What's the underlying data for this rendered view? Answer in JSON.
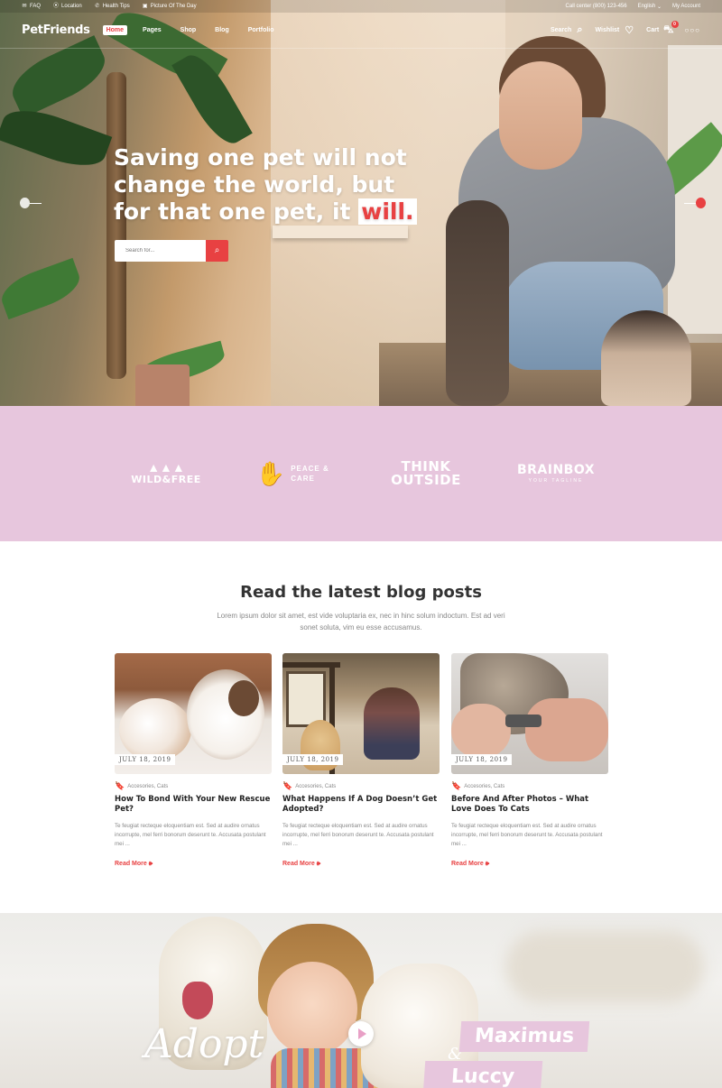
{
  "topbar": {
    "left": [
      {
        "icon": "chat-icon",
        "label": "FAQ"
      },
      {
        "icon": "location-pin-icon",
        "label": "Location"
      },
      {
        "icon": "phone-icon",
        "label": "Health Tips"
      },
      {
        "icon": "camera-icon",
        "label": "Picture Of The Day"
      }
    ],
    "call_center": "Call center (800) 123-456",
    "language": "English",
    "account": "My Account"
  },
  "header": {
    "logo": "PetFriends",
    "nav": [
      {
        "label": "Home",
        "active": true
      },
      {
        "label": "Pages",
        "active": false
      },
      {
        "label": "Shop",
        "active": false
      },
      {
        "label": "Blog",
        "active": false
      },
      {
        "label": "Portfolio",
        "active": false
      }
    ],
    "search_label": "Search",
    "wishlist_label": "Wishlist",
    "cart_label": "Cart",
    "cart_count": "0",
    "more_icon": "ellipsis-icon"
  },
  "hero": {
    "title_part1": "Saving one pet will not change the world, but for that one pet, it",
    "title_highlight": "will.",
    "search_placeholder": "Search for..."
  },
  "brands": [
    {
      "name": "WILD&FREE"
    },
    {
      "name": "PEACE & CARE"
    },
    {
      "name": "THINK OUTSIDE"
    },
    {
      "name": "BRAINBOX",
      "tagline": "YOUR TAGLINE"
    }
  ],
  "blog": {
    "title": "Read the latest blog posts",
    "subtitle": "Lorem ipsum dolor sit amet, est vide voluptaria ex, nec in hinc solum indoctum. Est ad veri sonet soluta, vim eu esse accusamus.",
    "posts": [
      {
        "date": "JULY 18, 2019",
        "category": "Accesories, Cats",
        "title": "How To Bond With Your New Rescue Pet?",
        "excerpt": "Te feugiat recteque eloquentiam est. Sed at audire ornatus incorrupte, mel ferri bonorum deserunt te. Accusata postulant mei ...",
        "read_more": "Read More"
      },
      {
        "date": "JULY 18, 2019",
        "category": "Accesories, Cats",
        "title": "What Happens If A Dog Doesn’t Get Adopted?",
        "excerpt": "Te feugiat recteque eloquentiam est. Sed at audire ornatus incorrupte, mel ferri bonorum deserunt te. Accusata postulant mei ...",
        "read_more": "Read More"
      },
      {
        "date": "JULY 18, 2019",
        "category": "Accesories, Cats",
        "title": "Before And After Photos – What Love Does To Cats",
        "excerpt": "Te feugiat recteque eloquentiam est. Sed at audire ornatus incorrupte, mel ferri bonorum deserunt te. Accusata postulant mei ...",
        "read_more": "Read More"
      }
    ]
  },
  "adopt": {
    "script": "Adopt",
    "ampersand": "&",
    "name1": "Maximus",
    "name2": "Luccy"
  },
  "colors": {
    "accent": "#e84142",
    "brand_band": "#e7c6dd"
  }
}
